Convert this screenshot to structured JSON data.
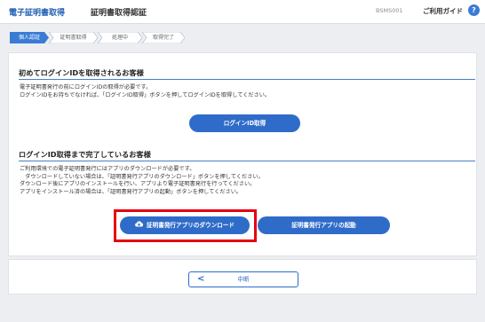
{
  "header": {
    "app_title": "電子証明書取得",
    "page_title": "証明書取得認証",
    "screen_id": "BSMS001",
    "help_label": "ご利用ガイド",
    "help_icon": "?"
  },
  "steps": [
    {
      "label": "個人認証",
      "state": "current"
    },
    {
      "label": "証明書取得",
      "state": "pending"
    },
    {
      "label": "処理中",
      "state": "pending"
    },
    {
      "label": "取得完了",
      "state": "pending"
    }
  ],
  "section1": {
    "heading": "初めてログインIDを取得されるお客様",
    "lines": [
      "電子証明書発行の前にログインIDの取得が必要です。",
      "ログインIDをお持ちでなければ、「ログインID取得」ボタンを押してログインIDを取得してください。"
    ],
    "button_label": "ログインID取得"
  },
  "section2": {
    "heading": "ログインID取得まで完了しているお客様",
    "lines": [
      "ご利用環境での電子証明書発行にはアプリのダウンロードが必要です。",
      "　ダウンロードしていない場合は、「証明書発行アプリのダウンロード」ボタンを押してください。",
      "ダウンロード後にアプリのインストールを行い、アプリより電子証明書発行を行ってください。",
      "アプリをインストール済の場合は、「証明書発行アプリの起動」ボタンを押してください。"
    ],
    "download_label": "証明書発行アプリのダウンロード",
    "launch_label": "証明書発行アプリの起動"
  },
  "footer": {
    "cancel_label": "中断",
    "cancel_icon": "<"
  },
  "colors": {
    "accent": "#2f6cc9",
    "highlight": "#e60012",
    "step_active": "#3a7bd5"
  }
}
